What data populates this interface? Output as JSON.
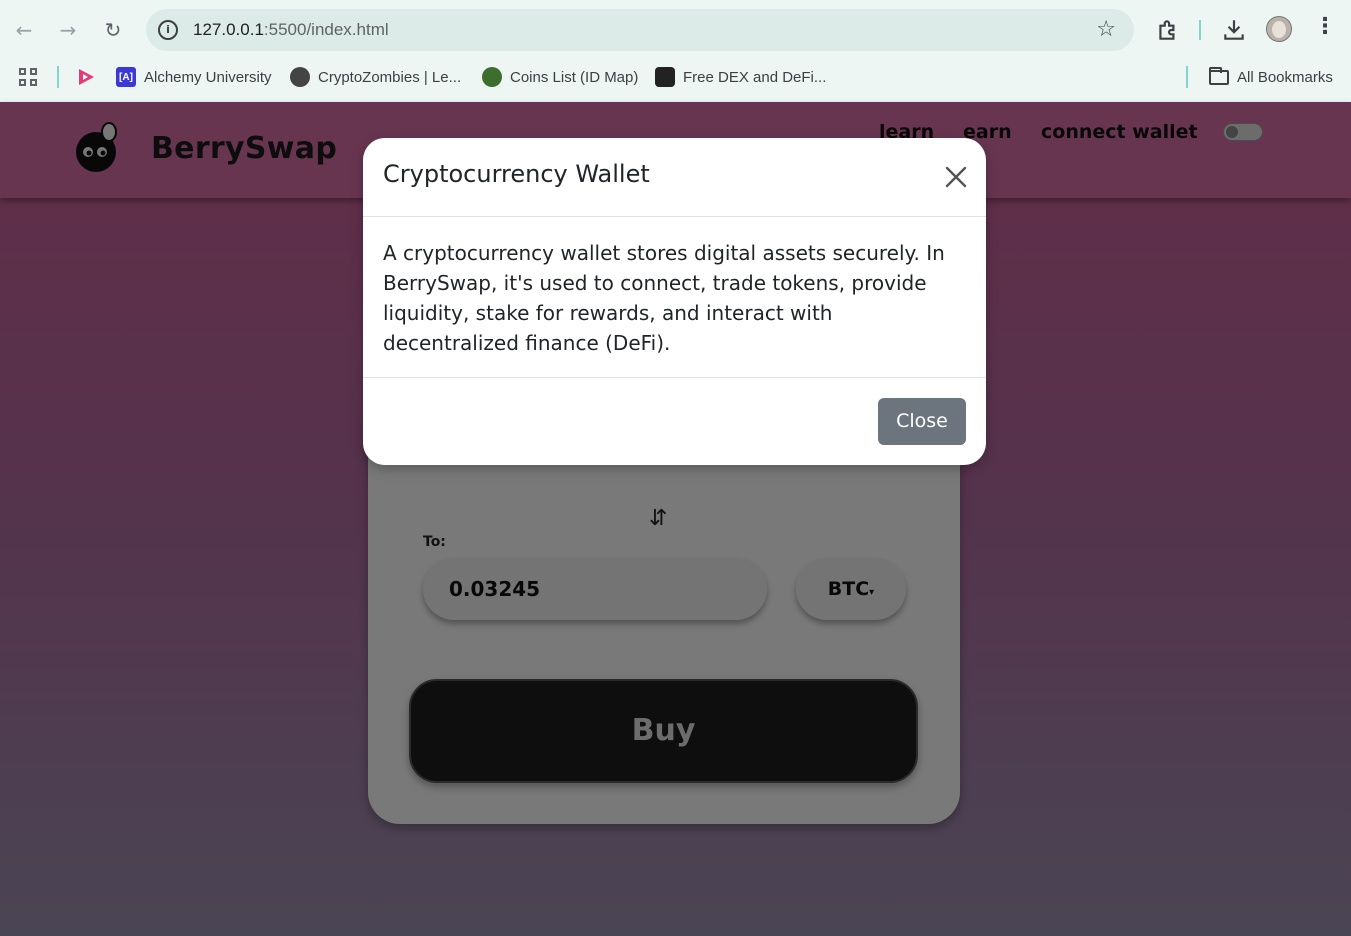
{
  "browser": {
    "url_host": "127.0.0.1",
    "url_path": ":5500/index.html",
    "bookmarks": [
      {
        "label": "Alchemy University",
        "icon": "alchemy-icon"
      },
      {
        "label": "CryptoZombies | Le...",
        "icon": "globe-icon"
      },
      {
        "label": "Coins List (ID Map)",
        "icon": "coingecko-icon"
      },
      {
        "label": "Free DEX and DeFi...",
        "icon": "dex-icon"
      }
    ],
    "all_bookmarks": "All Bookmarks",
    "alchemy_badge": "[A]"
  },
  "site": {
    "brand": "BerrySwap",
    "nav": {
      "learn": "learn",
      "earn": "earn",
      "connect": "connect wallet"
    },
    "swap": {
      "swap_icon": "⇵",
      "to_label": "To:",
      "to_value": "0.03245",
      "to_token": "BTC",
      "to_caret": "▾",
      "buy_label": "Buy"
    }
  },
  "modal": {
    "title": "Cryptocurrency Wallet",
    "body": "A cryptocurrency wallet stores digital assets securely. In BerrySwap, it's used to connect, trade tokens, provide liquidity, stake for rewards, and interact with decentralized finance (DeFi).",
    "close_label": "Close"
  },
  "colors": {
    "header_pink": "#d16aa0",
    "close_button": "#6c757d",
    "buy_button": "#1c1c1c"
  }
}
